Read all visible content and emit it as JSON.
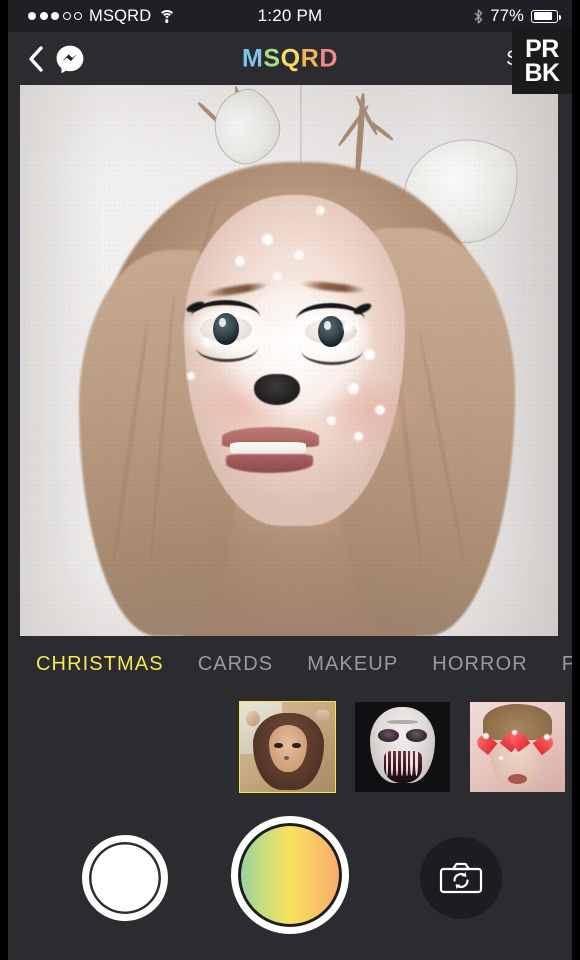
{
  "status_bar": {
    "signal_dots_filled": 3,
    "signal_dots_total": 5,
    "carrier": "MSQRD",
    "wifi_icon": "wifi-icon",
    "time": "1:20 PM",
    "bluetooth_icon": "bluetooth-icon",
    "battery_percent": "77%",
    "battery_level": 77
  },
  "nav_bar": {
    "back_icon": "back-chevron-icon",
    "messenger_icon": "messenger-icon",
    "title": "MSQRD",
    "title_letters": [
      {
        "char": "M",
        "color": "#7fc6e8"
      },
      {
        "char": "S",
        "color": "#a9dd8a"
      },
      {
        "char": "Q",
        "color": "#f4de5e"
      },
      {
        "char": "R",
        "color": "#f5b25c"
      },
      {
        "char": "D",
        "color": "#f08a8a"
      }
    ],
    "share_label": "Share"
  },
  "watermark": {
    "line1": "PR",
    "line2": "BK"
  },
  "preview": {
    "description": "Front-facing selfie of a blonde woman wearing the Christmas deer mask filter: white face markings, black deer nose, white spots on cheeks and forehead, long dramatic eyelashes, deer ears and antlers overlaid on her head, light grey wall background."
  },
  "categories": {
    "items": [
      {
        "label": "CHRISTMAS",
        "active": true
      },
      {
        "label": "CARDS",
        "active": false
      },
      {
        "label": "MAKEUP",
        "active": false
      },
      {
        "label": "HORROR",
        "active": false
      },
      {
        "label": "FACES",
        "active": false
      }
    ],
    "active_color": "#f5eb4e",
    "inactive_color": "#9a9a9f"
  },
  "filters": {
    "items": [
      {
        "name": "deer-filter",
        "selected": true
      },
      {
        "name": "horror-skull-filter",
        "selected": false
      },
      {
        "name": "heart-eyes-filter",
        "selected": false
      }
    ],
    "selection_border_color": "#f2e84d"
  },
  "controls": {
    "gallery_label": "gallery-button",
    "shutter_label": "shutter-button",
    "shutter_gradient": [
      "#93cfa4",
      "#f7e15e",
      "#f6a86b"
    ],
    "flip_camera_label": "flip-camera-button"
  },
  "theme": {
    "background": "#2b2b30",
    "status_bar_background": "#202024",
    "text_primary": "#ffffff"
  }
}
